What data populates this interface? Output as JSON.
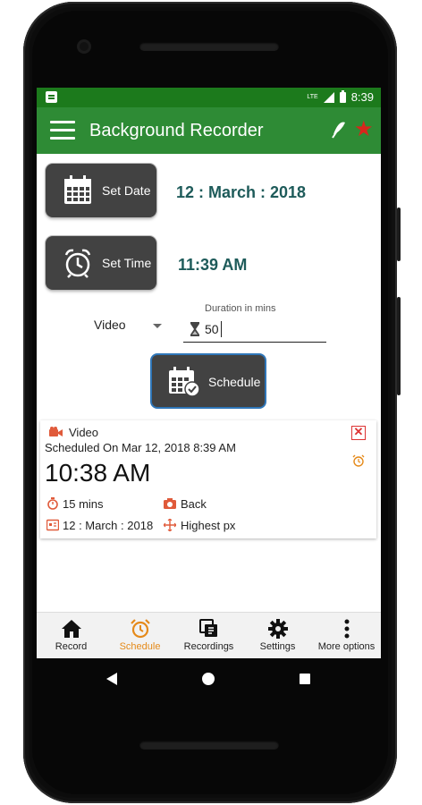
{
  "status_bar": {
    "network": "LTE",
    "time": "8:39"
  },
  "app_bar": {
    "title": "Background Recorder",
    "icons": [
      "menu-icon",
      "pen-icon",
      "star-icon"
    ],
    "star_color": "#d8261c"
  },
  "schedule_form": {
    "set_date_label": "Set Date",
    "date_value": "12 : March : 2018",
    "set_time_label": "Set Time",
    "time_value": "11:39 AM",
    "media_type_selected": "Video",
    "duration_label": "Duration in mins",
    "duration_value": "50",
    "schedule_button_label": "Schedule"
  },
  "scheduled_items": [
    {
      "type": "Video",
      "scheduled_on": "Scheduled On Mar 12, 2018  8:39 AM",
      "time": "10:38 AM",
      "duration": "15 mins",
      "camera": "Back",
      "date": "12 : March : 2018",
      "resolution": "Highest px"
    }
  ],
  "bottom_nav": {
    "active": "Schedule",
    "items": [
      {
        "label": "Record",
        "icon": "home-icon"
      },
      {
        "label": "Schedule",
        "icon": "alarm-clock-icon"
      },
      {
        "label": "Recordings",
        "icon": "recordings-icon"
      },
      {
        "label": "Settings",
        "icon": "gear-icon"
      },
      {
        "label": "More options",
        "icon": "more-vert-icon"
      }
    ]
  },
  "colors": {
    "status_bar": "#1c7a1c",
    "app_bar": "#2e8b35",
    "value_text": "#1e5b5a",
    "active_nav": "#e58a1a",
    "danger": "#d33333",
    "accent_icon": "#e05a3a"
  }
}
